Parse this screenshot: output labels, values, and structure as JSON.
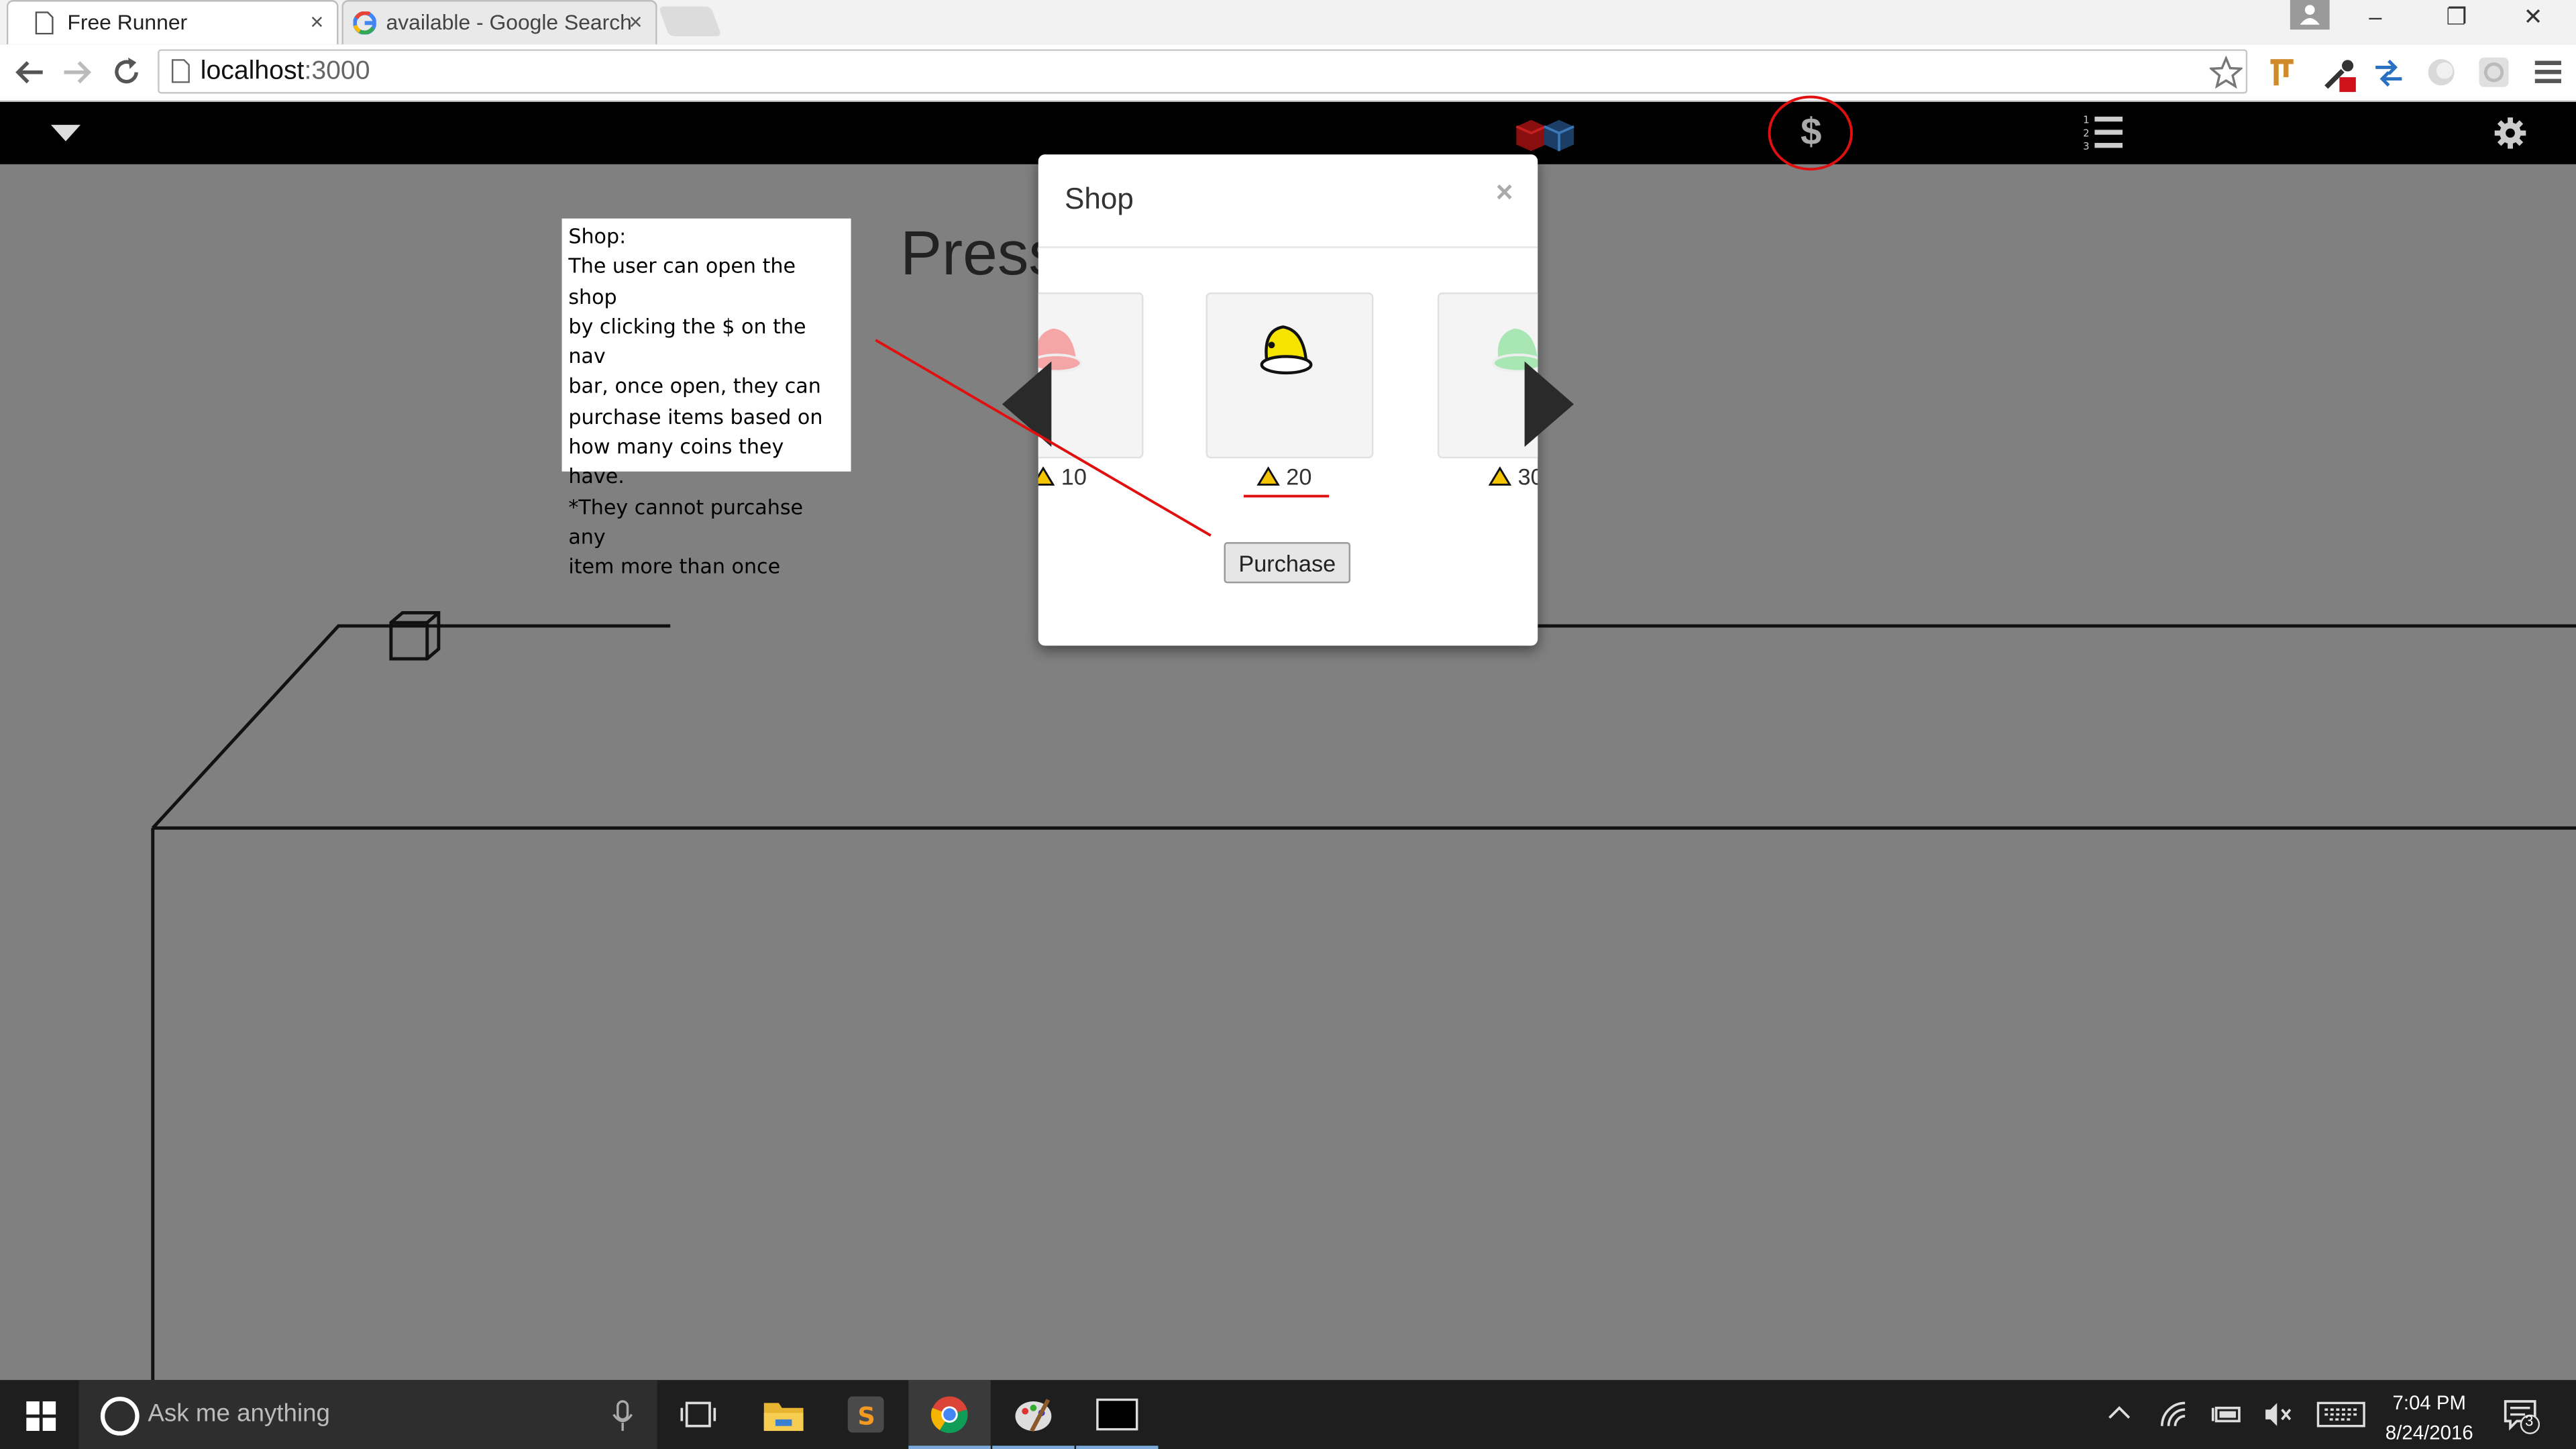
{
  "browser": {
    "tabs": [
      {
        "title": "Free Runner",
        "close": "×"
      },
      {
        "title": "available - Google Search",
        "close": "×"
      }
    ],
    "url_host": "localhost",
    "url_port": ":3000"
  },
  "window_controls": {
    "minimize": "–",
    "restore": "❐",
    "close": "✕"
  },
  "navbar": {
    "shop_icon": "$"
  },
  "game": {
    "press_text": "Press Start"
  },
  "note": {
    "lines": [
      "Shop:",
      "The user can open the shop",
      "by clicking the $ on the nav",
      "bar, once open, they can",
      "purchase items based on",
      "how many coins they have.",
      "*They cannot purcahse any",
      "item more than once"
    ]
  },
  "shop": {
    "title": "Shop",
    "close": "×",
    "items": [
      {
        "price": "10",
        "color": "#f4a6a6"
      },
      {
        "price": "20",
        "color": "#f5e400"
      },
      {
        "price": "30",
        "color": "#a8e6b4"
      }
    ],
    "purchase_label": "Purchase",
    "coin_color": "#f5c400"
  },
  "annotation_colors": {
    "red": "#e01010"
  },
  "taskbar": {
    "search_placeholder": "Ask me anything",
    "time": "7:04 PM",
    "date": "8/24/2016",
    "notifications": "3"
  }
}
